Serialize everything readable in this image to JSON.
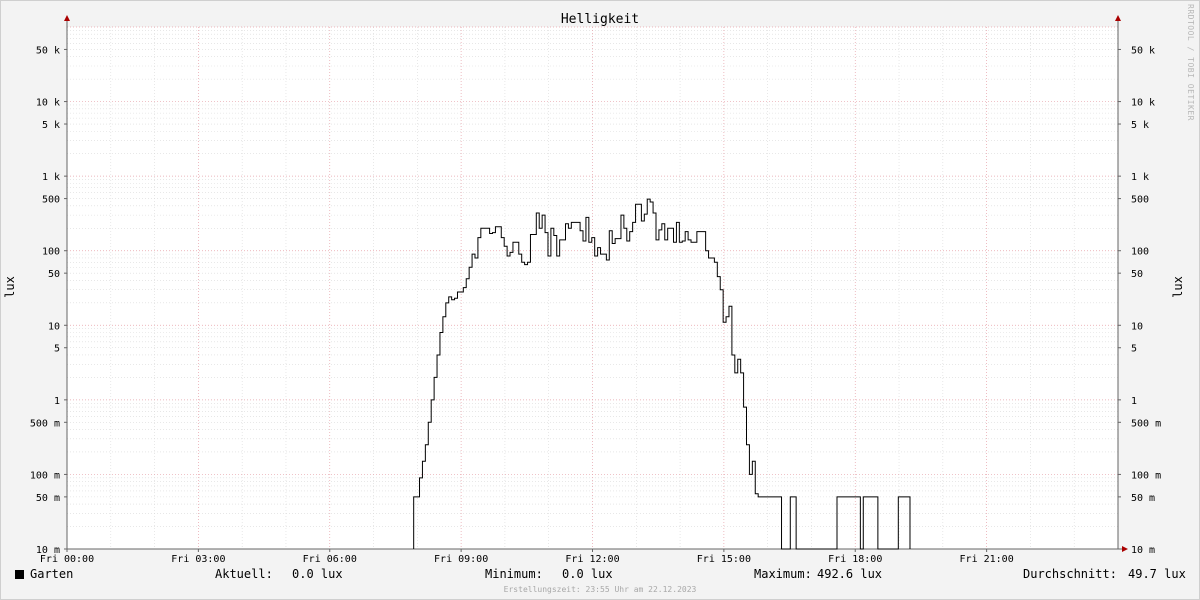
{
  "chart_data": {
    "type": "line",
    "title": "Helligkeit",
    "ylabel": "lux",
    "yscale": "log",
    "ylim": [
      0.01,
      100000
    ],
    "xlim": [
      "Fri 00:00",
      "Sat 00:00"
    ],
    "grid": true,
    "x_ticks": [
      "Fri 00:00",
      "Fri 03:00",
      "Fri 06:00",
      "Fri 09:00",
      "Fri 12:00",
      "Fri 15:00",
      "Fri 18:00",
      "Fri 21:00"
    ],
    "y_ticks": [
      {
        "label": "10 m",
        "value": 0.01
      },
      {
        "label": "50 m",
        "value": 0.05
      },
      {
        "label": "100 m",
        "value": 0.1
      },
      {
        "label": "500 m",
        "value": 0.5
      },
      {
        "label": "1",
        "value": 1
      },
      {
        "label": "5",
        "value": 5
      },
      {
        "label": "10",
        "value": 10
      },
      {
        "label": "50",
        "value": 50
      },
      {
        "label": "100",
        "value": 100
      },
      {
        "label": "500",
        "value": 500
      },
      {
        "label": "1 k",
        "value": 1000
      },
      {
        "label": "5 k",
        "value": 5000
      },
      {
        "label": "10 k",
        "value": 10000
      },
      {
        "label": "50 k",
        "value": 50000
      }
    ],
    "series": [
      {
        "name": "Garten",
        "color": "#000000",
        "points": [
          [
            "07:55",
            0.01
          ],
          [
            "07:55",
            0.05
          ],
          [
            "08:03",
            0.05
          ],
          [
            "08:03",
            0.09
          ],
          [
            "08:07",
            0.09
          ],
          [
            "08:07",
            0.15
          ],
          [
            "08:11",
            0.15
          ],
          [
            "08:11",
            0.25
          ],
          [
            "08:15",
            0.25
          ],
          [
            "08:15",
            0.5
          ],
          [
            "08:19",
            0.5
          ],
          [
            "08:19",
            1.0
          ],
          [
            "08:23",
            1.0
          ],
          [
            "08:23",
            2.0
          ],
          [
            "08:27",
            2.0
          ],
          [
            "08:27",
            4.0
          ],
          [
            "08:31",
            4.0
          ],
          [
            "08:31",
            8.0
          ],
          [
            "08:35",
            8.0
          ],
          [
            "08:35",
            13
          ],
          [
            "08:39",
            13
          ],
          [
            "08:39",
            20
          ],
          [
            "08:43",
            20
          ],
          [
            "08:43",
            24
          ],
          [
            "08:47",
            24
          ],
          [
            "08:47",
            22
          ],
          [
            "08:51",
            22
          ],
          [
            "08:51",
            23
          ],
          [
            "08:55",
            23
          ],
          [
            "08:55",
            28
          ],
          [
            "09:03",
            28
          ],
          [
            "09:03",
            32
          ],
          [
            "09:07",
            32
          ],
          [
            "09:07",
            42
          ],
          [
            "09:11",
            42
          ],
          [
            "09:11",
            60
          ],
          [
            "09:15",
            60
          ],
          [
            "09:15",
            90
          ],
          [
            "09:19",
            90
          ],
          [
            "09:19",
            80
          ],
          [
            "09:23",
            80
          ],
          [
            "09:23",
            150
          ],
          [
            "09:27",
            150
          ],
          [
            "09:27",
            200
          ],
          [
            "09:39",
            200
          ],
          [
            "09:39",
            170
          ],
          [
            "09:43",
            170
          ],
          [
            "09:43",
            175
          ],
          [
            "09:47",
            175
          ],
          [
            "09:47",
            210
          ],
          [
            "09:55",
            210
          ],
          [
            "09:55",
            150
          ],
          [
            "09:59",
            150
          ],
          [
            "09:59",
            115
          ],
          [
            "10:03",
            115
          ],
          [
            "10:03",
            85
          ],
          [
            "10:07",
            85
          ],
          [
            "10:07",
            95
          ],
          [
            "10:11",
            95
          ],
          [
            "10:11",
            130
          ],
          [
            "10:19",
            130
          ],
          [
            "10:19",
            90
          ],
          [
            "10:23",
            90
          ],
          [
            "10:23",
            70
          ],
          [
            "10:27",
            70
          ],
          [
            "10:27",
            65
          ],
          [
            "10:31",
            65
          ],
          [
            "10:31",
            70
          ],
          [
            "10:35",
            70
          ],
          [
            "10:35",
            165
          ],
          [
            "10:43",
            165
          ],
          [
            "10:43",
            320
          ],
          [
            "10:47",
            320
          ],
          [
            "10:47",
            200
          ],
          [
            "10:51",
            200
          ],
          [
            "10:51",
            300
          ],
          [
            "10:55",
            300
          ],
          [
            "10:55",
            175
          ],
          [
            "10:59",
            175
          ],
          [
            "10:59",
            85
          ],
          [
            "11:03",
            85
          ],
          [
            "11:03",
            200
          ],
          [
            "11:07",
            200
          ],
          [
            "11:07",
            160
          ],
          [
            "11:11",
            160
          ],
          [
            "11:11",
            85
          ],
          [
            "11:15",
            85
          ],
          [
            "11:15",
            140
          ],
          [
            "11:23",
            140
          ],
          [
            "11:23",
            230
          ],
          [
            "11:27",
            230
          ],
          [
            "11:27",
            200
          ],
          [
            "11:31",
            200
          ],
          [
            "11:31",
            240
          ],
          [
            "11:43",
            240
          ],
          [
            "11:43",
            185
          ],
          [
            "11:47",
            185
          ],
          [
            "11:47",
            135
          ],
          [
            "11:51",
            135
          ],
          [
            "11:51",
            280
          ],
          [
            "11:55",
            280
          ],
          [
            "11:55",
            130
          ],
          [
            "11:59",
            130
          ],
          [
            "11:59",
            150
          ],
          [
            "12:03",
            150
          ],
          [
            "12:03",
            85
          ],
          [
            "12:07",
            85
          ],
          [
            "12:07",
            110
          ],
          [
            "12:11",
            110
          ],
          [
            "12:11",
            90
          ],
          [
            "12:19",
            90
          ],
          [
            "12:19",
            75
          ],
          [
            "12:23",
            75
          ],
          [
            "12:23",
            185
          ],
          [
            "12:27",
            185
          ],
          [
            "12:27",
            125
          ],
          [
            "12:31",
            125
          ],
          [
            "12:31",
            145
          ],
          [
            "12:39",
            145
          ],
          [
            "12:39",
            300
          ],
          [
            "12:43",
            300
          ],
          [
            "12:43",
            200
          ],
          [
            "12:47",
            200
          ],
          [
            "12:47",
            135
          ],
          [
            "12:51",
            135
          ],
          [
            "12:51",
            180
          ],
          [
            "12:55",
            180
          ],
          [
            "12:55",
            240
          ],
          [
            "12:59",
            240
          ],
          [
            "12:59",
            420
          ],
          [
            "13:07",
            420
          ],
          [
            "13:07",
            250
          ],
          [
            "13:11",
            250
          ],
          [
            "13:11",
            310
          ],
          [
            "13:15",
            310
          ],
          [
            "13:15",
            492.6
          ],
          [
            "13:19",
            492.6
          ],
          [
            "13:19",
            450
          ],
          [
            "13:23",
            450
          ],
          [
            "13:23",
            320
          ],
          [
            "13:27",
            320
          ],
          [
            "13:27",
            140
          ],
          [
            "13:31",
            140
          ],
          [
            "13:31",
            190
          ],
          [
            "13:35",
            190
          ],
          [
            "13:35",
            230
          ],
          [
            "13:39",
            230
          ],
          [
            "13:39",
            140
          ],
          [
            "13:43",
            140
          ],
          [
            "13:43",
            200
          ],
          [
            "13:51",
            200
          ],
          [
            "13:51",
            130
          ],
          [
            "13:55",
            130
          ],
          [
            "13:55",
            240
          ],
          [
            "13:59",
            240
          ],
          [
            "13:59",
            130
          ],
          [
            "14:03",
            130
          ],
          [
            "14:03",
            135
          ],
          [
            "14:07",
            135
          ],
          [
            "14:07",
            180
          ],
          [
            "14:11",
            180
          ],
          [
            "14:11",
            140
          ],
          [
            "14:15",
            140
          ],
          [
            "14:15",
            130
          ],
          [
            "14:23",
            130
          ],
          [
            "14:23",
            180
          ],
          [
            "14:35",
            180
          ],
          [
            "14:35",
            100
          ],
          [
            "14:39",
            100
          ],
          [
            "14:39",
            80
          ],
          [
            "14:47",
            80
          ],
          [
            "14:47",
            70
          ],
          [
            "14:51",
            70
          ],
          [
            "14:51",
            45
          ],
          [
            "14:55",
            45
          ],
          [
            "14:55",
            30
          ],
          [
            "14:59",
            30
          ],
          [
            "14:59",
            11
          ],
          [
            "15:03",
            11
          ],
          [
            "15:03",
            13
          ],
          [
            "15:07",
            13
          ],
          [
            "15:07",
            18
          ],
          [
            "15:11",
            18
          ],
          [
            "15:11",
            4
          ],
          [
            "15:15",
            4
          ],
          [
            "15:15",
            2.3
          ],
          [
            "15:19",
            2.3
          ],
          [
            "15:19",
            3.5
          ],
          [
            "15:23",
            3.5
          ],
          [
            "15:23",
            2.3
          ],
          [
            "15:27",
            2.3
          ],
          [
            "15:27",
            0.8
          ],
          [
            "15:31",
            0.8
          ],
          [
            "15:31",
            0.25
          ],
          [
            "15:35",
            0.25
          ],
          [
            "15:35",
            0.1
          ],
          [
            "15:39",
            0.1
          ],
          [
            "15:39",
            0.15
          ],
          [
            "15:43",
            0.15
          ],
          [
            "15:43",
            0.055
          ],
          [
            "15:47",
            0.055
          ],
          [
            "15:47",
            0.05
          ],
          [
            "16:19",
            0.05
          ],
          [
            "16:19",
            0.01
          ],
          [
            "16:31",
            0.01
          ],
          [
            "16:31",
            0.05
          ],
          [
            "16:39",
            0.05
          ],
          [
            "16:39",
            0.01
          ],
          [
            "17:35",
            0.01
          ],
          [
            "17:35",
            0.05
          ],
          [
            "18:07",
            0.05
          ],
          [
            "18:07",
            0.01
          ],
          [
            "18:11",
            0.01
          ],
          [
            "18:11",
            0.05
          ],
          [
            "18:31",
            0.05
          ],
          [
            "18:31",
            0.01
          ],
          [
            "18:59",
            0.01
          ],
          [
            "18:59",
            0.05
          ],
          [
            "19:15",
            0.05
          ],
          [
            "19:15",
            0.01
          ]
        ]
      }
    ]
  },
  "legend": {
    "series_label": "Garten",
    "current_label": "Aktuell:",
    "current_value": "0.0 lux",
    "min_label": "Minimum:",
    "min_value": "0.0 lux",
    "max_label": "Maximum:",
    "max_value": "492.6 lux",
    "avg_label": "Durchschnitt:",
    "avg_value": "49.7 lux"
  },
  "footer": "Erstellungszeit: 23:55 Uhr am 22.12.2023",
  "watermark": "RRDTOOL / TOBI OETIKER"
}
